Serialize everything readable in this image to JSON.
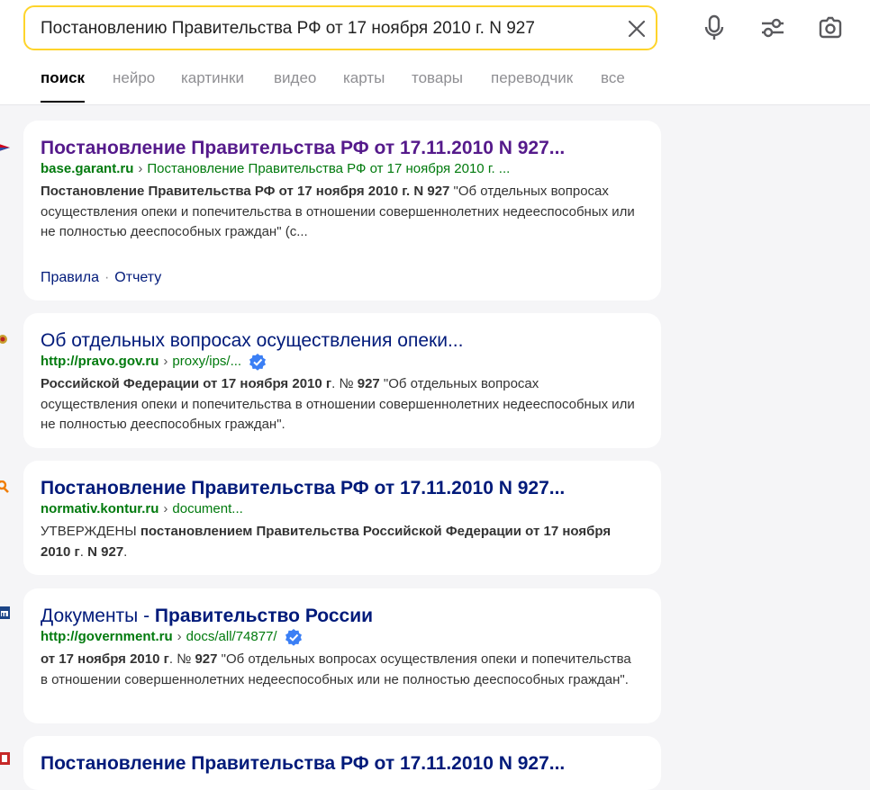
{
  "search": {
    "query": "Постановлению Правительства РФ от 17 ноября 2010 г. N 927"
  },
  "icons": {
    "clear": "close-icon",
    "voice": "microphone-icon",
    "settings": "sliders-icon",
    "camera": "camera-icon",
    "verified": "verified-check-icon"
  },
  "tabs": [
    "поиск",
    "нейро",
    "картинки",
    "видео",
    "карты",
    "товары",
    "переводчик",
    "все"
  ],
  "results": [
    {
      "title": "Постановление Правительства РФ от 17.11.2010 N 927...",
      "domain": "base.garant.ru",
      "path": "Постановление Правительства РФ от 17 ноября 2010 г. ...",
      "snippet_bold": "Постановление Правительства РФ от 17 ноября 2010 г. N 927",
      "snippet_rest": " \"Об отдельных вопросах осуществления опеки и попечительства в отношении совершеннолетних недееспособных или не полностью дееспособных граждан\" (с...",
      "sitelinks": [
        "Правила",
        "Отчету"
      ]
    },
    {
      "title": "Об отдельных вопросах осуществления опеки...",
      "domain": "http://pravo.gov.ru",
      "path": "proxy/ips/...",
      "snippet_b1": "Российской Федерации от 17 ноября 2010 г",
      "snippet_t1": ". № ",
      "snippet_b2": "927",
      "snippet_t2": " \"Об отдельных вопросах осуществления опеки и попечительства в отношении совершеннолетних недееспособных или не полностью дееспособных граждан\"."
    },
    {
      "title": "Постановление Правительства РФ от 17.11.2010 N 927...",
      "domain": "normativ.kontur.ru",
      "path": "document...",
      "snippet_t1": "УТВЕРЖДЕНЫ ",
      "snippet_b1": "постановлением Правительства Российской Федерации от 17 ноября 2010 г",
      "snippet_t2": ". ",
      "snippet_b2": "N 927",
      "snippet_t3": "."
    },
    {
      "title_plain": "Документы - ",
      "title_bold": "Правительство России",
      "domain": "http://government.ru",
      "path": "docs/all/74877/",
      "snippet_b1": "от 17 ноября 2010 г",
      "snippet_t1": ". № ",
      "snippet_b2": "927",
      "snippet_t2": " \"Об отдельных вопросах осуществления опеки и попечительства в отношении совершеннолетних недееспособных или не полностью дееспособных граждан\"."
    },
    {
      "title": "Постановление Правительства РФ от 17.11.2010 N 927..."
    }
  ],
  "colors": {
    "accent_yellow": "#fed42b",
    "link_blue": "#001a7a",
    "link_visited": "#551a8b",
    "url_green": "#007a0d",
    "verified_blue": "#3b7ff5"
  }
}
